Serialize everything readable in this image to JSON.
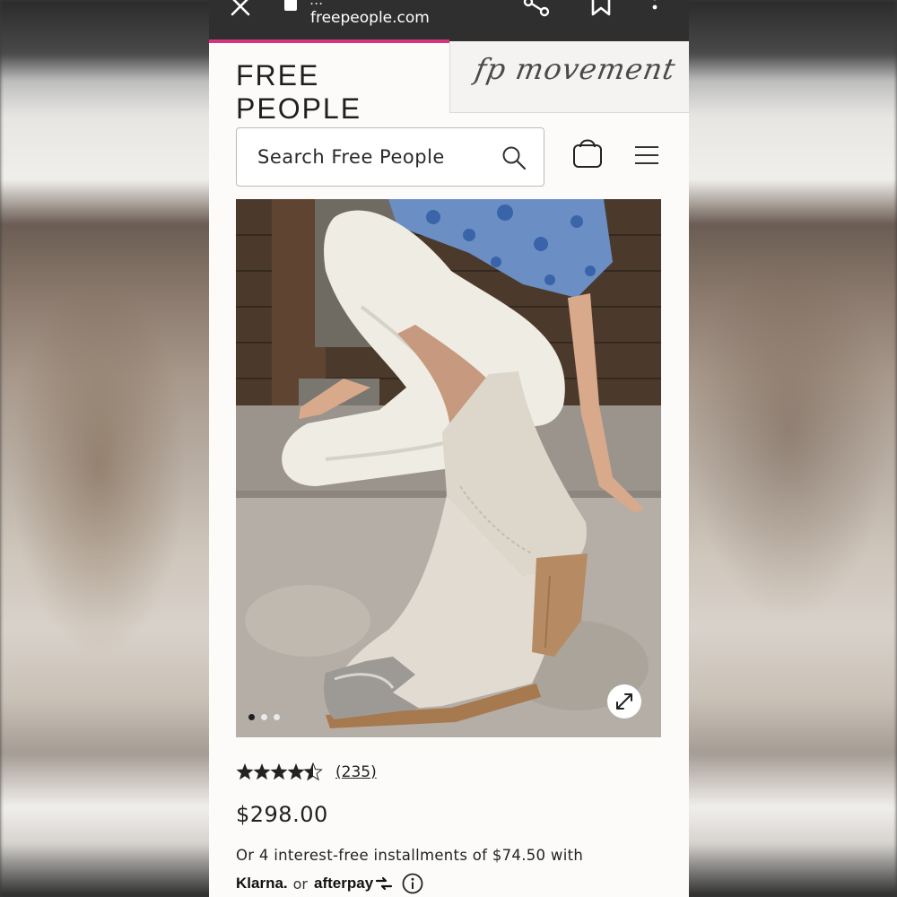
{
  "browser": {
    "title_partial": "...",
    "url": "freepeople.com",
    "progress_percent": 50
  },
  "header": {
    "brand": "FREE PEOPLE",
    "movement_brand": "fp movement"
  },
  "search": {
    "placeholder": "Search Free People"
  },
  "product": {
    "image_alt": "White western ankle boot with silver metal toe cap",
    "carousel": {
      "total": 3,
      "active_index": 0
    },
    "rating": 4.5,
    "review_count": "(235)",
    "price": "$298.00",
    "installments_text": "Or 4 interest-free installments of $74.50 with",
    "klarna_label": "Klarna.",
    "or_label": "or",
    "afterpay_label": "afterpay"
  },
  "colors": {
    "progress": "#d4357c",
    "chrome_bg": "#2f2f2f",
    "page_bg": "#fdfbfa"
  }
}
